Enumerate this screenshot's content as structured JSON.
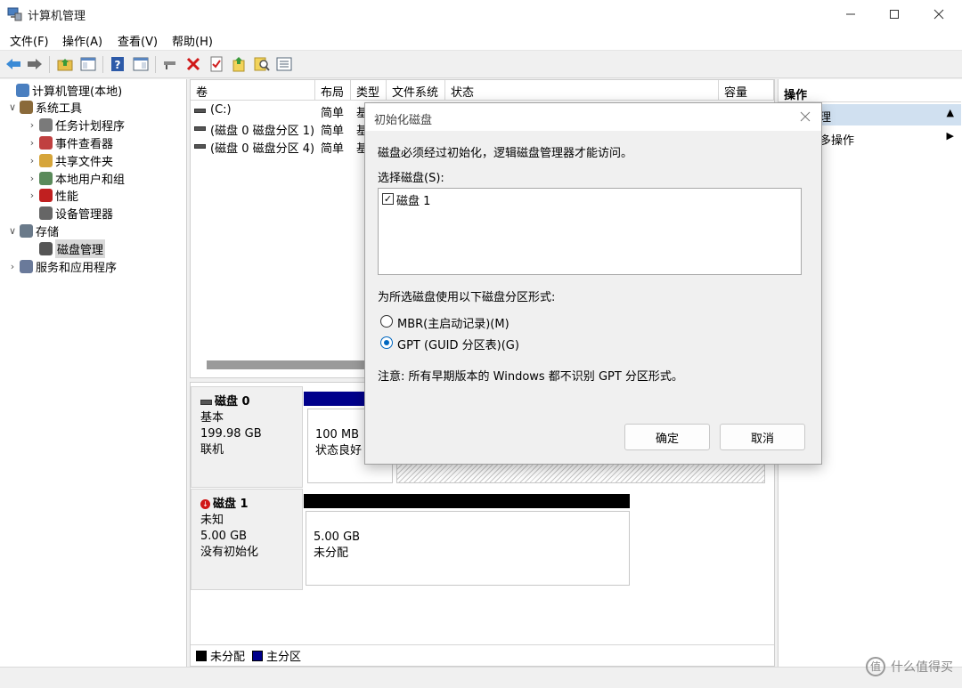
{
  "window": {
    "title": "计算机管理"
  },
  "menu": [
    "文件(F)",
    "操作(A)",
    "查看(V)",
    "帮助(H)"
  ],
  "toolbar_icons": [
    "back-icon",
    "forward-icon",
    "up-folder-icon",
    "console-tree-icon",
    "help-icon",
    "view-icon",
    "connect-icon",
    "delete-icon",
    "properties-icon",
    "open-icon",
    "search-icon",
    "list-icon"
  ],
  "tree": [
    {
      "label": "计算机管理(本地)",
      "level": 0,
      "arrow": "",
      "icon": "computer-management-icon"
    },
    {
      "label": "系统工具",
      "level": 1,
      "arrow": "∨",
      "icon": "system-tools-icon"
    },
    {
      "label": "任务计划程序",
      "level": 2,
      "arrow": "›",
      "icon": "task-scheduler-icon"
    },
    {
      "label": "事件查看器",
      "level": 2,
      "arrow": "›",
      "icon": "event-viewer-icon"
    },
    {
      "label": "共享文件夹",
      "level": 2,
      "arrow": "›",
      "icon": "shared-folder-icon"
    },
    {
      "label": "本地用户和组",
      "level": 2,
      "arrow": "›",
      "icon": "users-icon"
    },
    {
      "label": "性能",
      "level": 2,
      "arrow": "›",
      "icon": "performance-icon"
    },
    {
      "label": "设备管理器",
      "level": 2,
      "arrow": "",
      "icon": "device-manager-icon"
    },
    {
      "label": "存储",
      "level": 1,
      "arrow": "∨",
      "icon": "storage-icon"
    },
    {
      "label": "磁盘管理",
      "level": 2,
      "arrow": "",
      "icon": "disk-management-icon",
      "selected": true
    },
    {
      "label": "服务和应用程序",
      "level": 1,
      "arrow": "›",
      "icon": "services-icon"
    }
  ],
  "volume_columns": [
    "卷",
    "布局",
    "类型",
    "文件系统",
    "状态",
    "容量"
  ],
  "volumes": [
    {
      "name": "(C:)",
      "layout": "简单",
      "type": "基"
    },
    {
      "name": "(磁盘 0 磁盘分区 1)",
      "layout": "简单",
      "type": "基"
    },
    {
      "name": "(磁盘 0 磁盘分区 4)",
      "layout": "简单",
      "type": "基"
    }
  ],
  "disks": [
    {
      "name": "磁盘 0",
      "kind": "基本",
      "size": "199.98 GB",
      "state": "联机",
      "partition": {
        "size": "100 MB",
        "status": "状态良好 ("
      }
    },
    {
      "name": "磁盘 1",
      "kind": "未知",
      "size": "5.00 GB",
      "state": "没有初始化",
      "partition": {
        "size": "5.00 GB",
        "status": "未分配"
      }
    }
  ],
  "legend": [
    {
      "label": "未分配",
      "color": "#000000"
    },
    {
      "label": "主分区",
      "color": "#00008b"
    }
  ],
  "actions": {
    "header": "操作",
    "sub": "理",
    "more": "多操作"
  },
  "dialog": {
    "title": "初始化磁盘",
    "message": "磁盘必须经过初始化，逻辑磁盘管理器才能访问。",
    "select_label": "选择磁盘(S):",
    "disk_item": "磁盘 1",
    "partition_label": "为所选磁盘使用以下磁盘分区形式:",
    "mbr_label": "MBR(主启动记录)(M)",
    "gpt_label": "GPT (GUID 分区表)(G)",
    "note": "注意: 所有早期版本的 Windows 都不识别 GPT 分区形式。",
    "ok": "确定",
    "cancel": "取消"
  },
  "watermark": "什么值得买"
}
